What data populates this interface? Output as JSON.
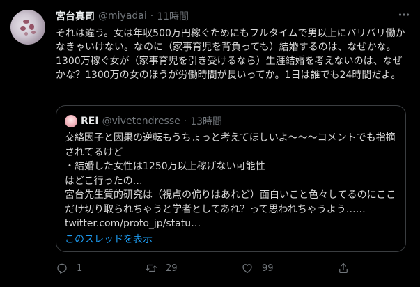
{
  "tweet": {
    "author_name": "宮台真司",
    "handle": "@miyadai",
    "separator": "·",
    "time": "11時間",
    "more_icon": "more-icon",
    "text": "それは違う。女は年収500万円稼ぐためにもフルタイムで男以上にバリバリ働かなきゃいけない。なのに（家事育児を背負っても）結婚するのは、なぜかな。1300万稼ぐ女が（家事育児を引き受けるなら）生涯結婚を考えないのは、なぜかな？1300万の女のほうが労働時間が長いってか。1日は誰でも24時間だよ。"
  },
  "quote": {
    "author_name": "REI",
    "handle": "@vivetendresse",
    "separator": "·",
    "time": "13時間",
    "text": "交絡因子と因果の逆転もうちょっと考えてほしいよ〜〜〜コメントでも指摘されてるけど\n・結婚した女性は1250万以上稼げない可能性\nはどこ行ったの…\n宮台先生質的研究は（視点の偏りはあれど）面白いこと色々してるのにここだけ切り取られちゃうと学者としてあれ？って思われちゃうよう…… twitter.com/proto_jp/statu…",
    "show_thread": "このスレッドを表示"
  },
  "actions": {
    "reply_count": "1",
    "retweet_count": "29",
    "like_count": "99",
    "share_count": ""
  },
  "colors": {
    "background": "#000000",
    "text": "#d9d9d9",
    "muted": "#71767b",
    "link": "#1d9bf0",
    "border": "#3a3d40"
  }
}
